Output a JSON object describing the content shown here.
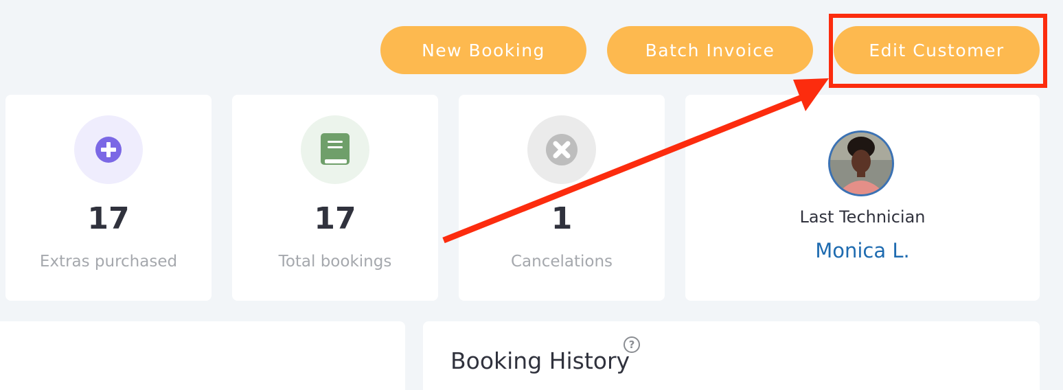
{
  "toolbar": {
    "new_booking_label": "New Booking",
    "batch_invoice_label": "Batch Invoice",
    "edit_customer_label": "Edit Customer"
  },
  "stats": [
    {
      "value": "17",
      "label": "Extras purchased",
      "icon": "plus-circle-icon",
      "icon_color": "#7b68e5",
      "icon_bg": "#efedfd"
    },
    {
      "value": "17",
      "label": "Total bookings",
      "icon": "book-icon",
      "icon_color": "#6f9f6a",
      "icon_bg": "#ecf4ec"
    },
    {
      "value": "1",
      "label": "Cancelations",
      "icon": "x-circle-icon",
      "icon_color": "#bdbdbd",
      "icon_bg": "#ebebeb"
    }
  ],
  "technician": {
    "label": "Last Technician",
    "name": "Monica L."
  },
  "booking_history": {
    "title": "Booking History",
    "help": "?"
  },
  "colors": {
    "accent_button": "#fdb94f",
    "annotation_red": "#fc2c0e",
    "link_blue": "#1e6bb0",
    "background": "#f2f5f8"
  }
}
